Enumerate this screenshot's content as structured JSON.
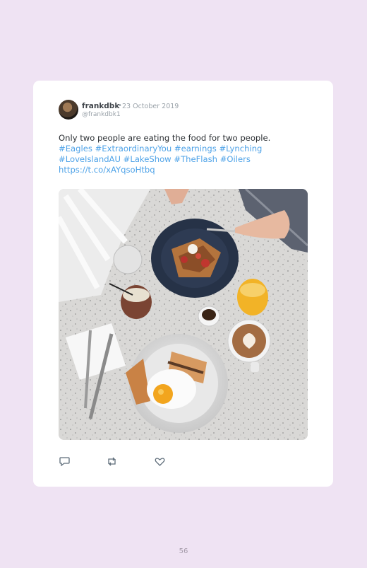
{
  "tweet": {
    "username": "frankdbk",
    "separator": "•",
    "date": "23 October 2019",
    "handle": "@frankdbk1",
    "text_line": "Only two people are eating the food for two people.",
    "hashtags": [
      "#Eagles",
      "#ExtraordinaryYou",
      "#earnings",
      "#Lynching",
      "#LoveIslandAU",
      "#LakeShow",
      "#TheFlash",
      "#Oilers"
    ],
    "link": "https://t.co/xAYqsoHtbq"
  },
  "icons": {
    "reply": "reply-icon",
    "retweet": "retweet-icon",
    "like": "heart-icon"
  },
  "page_number": "56"
}
